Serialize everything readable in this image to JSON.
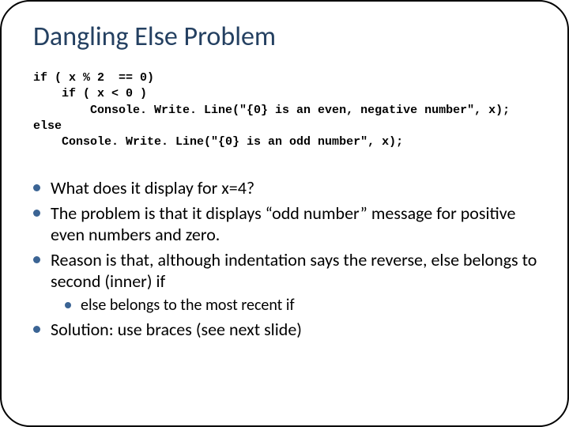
{
  "title": "Dangling Else Problem",
  "code": "if ( x % 2  == 0)\n    if ( x < 0 )\n        Console. Write. Line(\"{0} is an even, negative number\", x);\nelse\n    Console. Write. Line(\"{0} is an odd number\", x);",
  "bullets": [
    {
      "text": "What does it display for x=4?"
    },
    {
      "text": "The problem is that it displays “odd number” message for positive even numbers and zero."
    },
    {
      "text": "Reason is that, although indentation says the reverse, else belongs to second (inner) if",
      "sub": [
        "else belongs to the most recent if"
      ]
    },
    {
      "text": "Solution: use braces (see next slide)"
    }
  ]
}
